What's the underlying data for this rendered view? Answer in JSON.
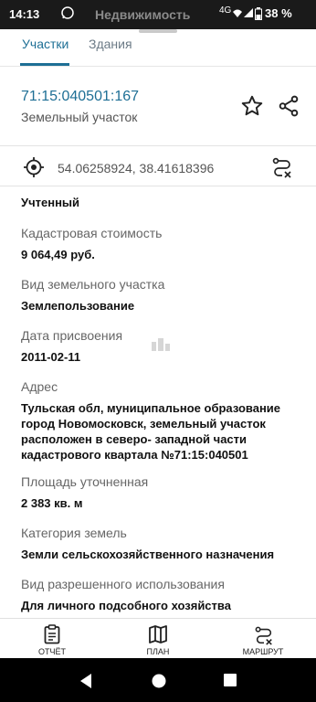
{
  "status_bar": {
    "time": "14:13",
    "app_overlay": "Недвижимость",
    "network": "4G",
    "battery": "38 %"
  },
  "tabs": [
    {
      "label": "Участки",
      "active": true
    },
    {
      "label": "Здания",
      "active": false
    }
  ],
  "object": {
    "cadastral_number": "71:15:040501:167",
    "type": "Земельный участок"
  },
  "coordinates": "54.06258924, 38.41618396",
  "status_value": "Учтенный",
  "fields": {
    "cost": {
      "label": "Кадастровая стоимость",
      "value": "9 064,49 руб."
    },
    "land_kind": {
      "label": "Вид земельного участка",
      "value": "Землепользование"
    },
    "assigned": {
      "label": "Дата присвоения",
      "value": "2011-02-11"
    },
    "address": {
      "label": "Адрес",
      "value": "Тульская обл, муниципальное образование город Новомосковск, земельный участок расположен в северо- западной части кадастрового квартала №71:15:040501"
    },
    "area": {
      "label": "Площадь уточненная",
      "value": "2 383 кв. м"
    },
    "category": {
      "label": "Категория земель",
      "value": "Земли сельскохозяйственного назначения"
    },
    "permitted_use": {
      "label": "Вид разрешенного использования",
      "value": "Для личного подсобного хозяйства"
    }
  },
  "bottom_nav": [
    {
      "label": "ОТЧЁТ",
      "icon": "report-icon"
    },
    {
      "label": "ПЛАН",
      "icon": "map-icon"
    },
    {
      "label": "МАРШРУТ",
      "icon": "route-icon"
    }
  ],
  "colors": {
    "accent": "#1e6f95",
    "status_bar": "#1a1a1a"
  }
}
